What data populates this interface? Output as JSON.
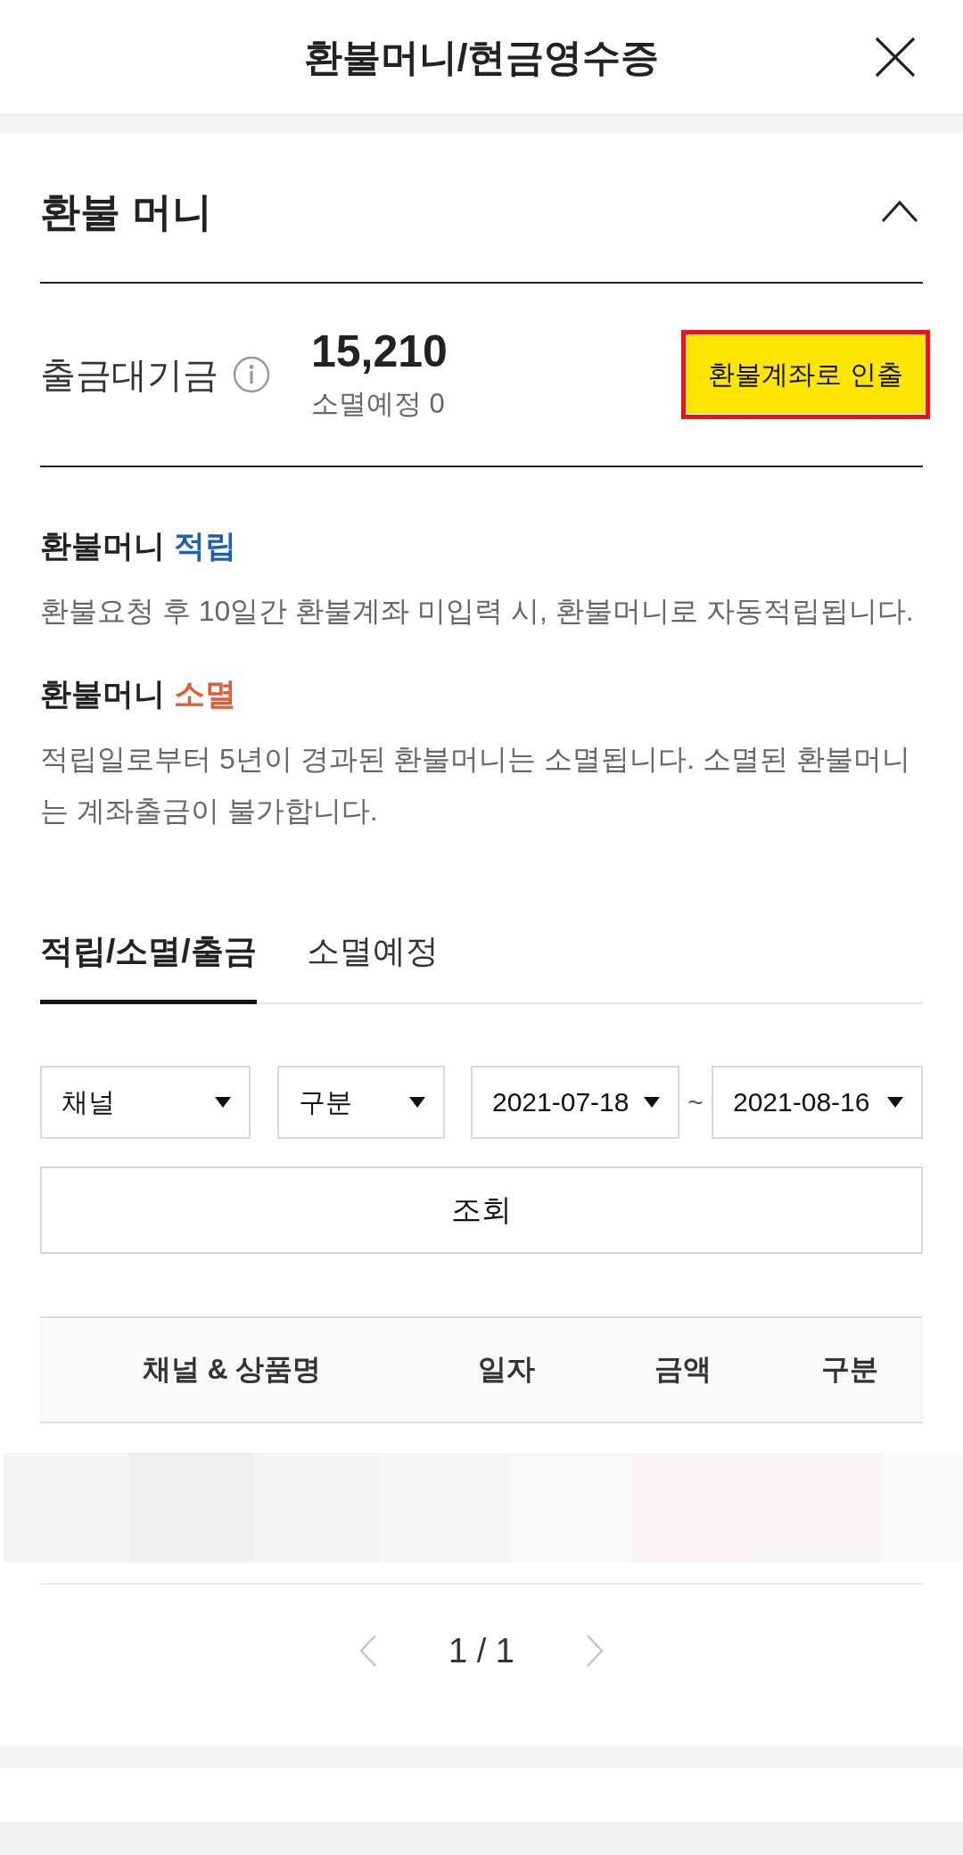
{
  "header": {
    "title": "환불머니/현금영수증"
  },
  "section": {
    "title": "환불 머니",
    "expanded": true
  },
  "balance": {
    "label": "출금대기금",
    "amount": "15,210",
    "expiring": "소멸예정 0",
    "button": {
      "label": "환불계좌로 인출",
      "highlighted": true
    }
  },
  "notices": [
    {
      "title": "환불머니",
      "keyword": "적립",
      "color": "#1f5fae",
      "text": "환불요청 후 10일간 환불계좌 미입력 시, 환불머니로 자동적립됩니다."
    },
    {
      "title": "환불머니",
      "keyword": "소멸",
      "color": "#e05d3a",
      "text": "적립일로부터 5년이 경과된 환불머니는 소멸됩니다. 소멸된 환불머니는 계좌출금이 불가합니다."
    }
  ],
  "tabs": [
    {
      "label": "적립/소멸/출금",
      "selected": true
    },
    {
      "label": "소멸예정",
      "selected": false
    }
  ],
  "filters": {
    "channel": "채널",
    "category": "구분",
    "date_from": "2021-07-18",
    "date_separator": "~",
    "date_to": "2021-08-16"
  },
  "search_button": {
    "label": "조회"
  },
  "table": {
    "columns": [
      "채널 & 상품명",
      "일자",
      "금액",
      "구분"
    ],
    "rows": [
      {
        "redacted": true
      }
    ]
  },
  "pagination": {
    "page": "1 / 1",
    "prev": {
      "disabled": true
    },
    "next": {
      "disabled": true
    }
  }
}
